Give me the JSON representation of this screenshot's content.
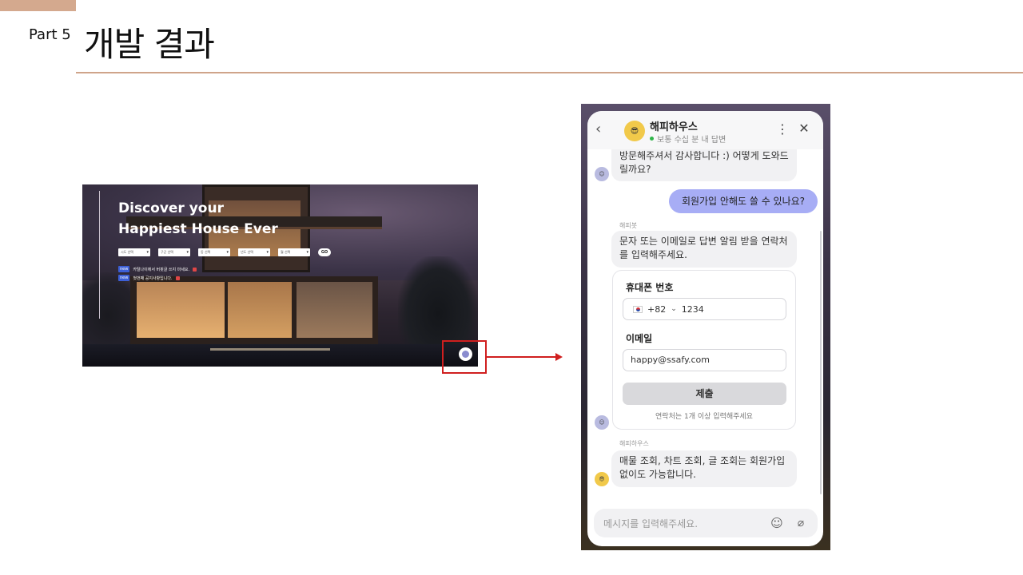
{
  "slide": {
    "part_label": "Part 5",
    "title": "개발 결과"
  },
  "website": {
    "hero_line1": "Discover your",
    "hero_line2": "Happiest House Ever",
    "selects": [
      "시도 선택",
      "구군 선택",
      "동 선택",
      "년도 선택",
      "월 선택"
    ],
    "go_label": "GO",
    "notices": [
      {
        "badge": "new",
        "text": "카탈나이에서 버핏글 쓰지 마세요."
      },
      {
        "badge": "new",
        "text": "첫번째 공지사항입니다."
      }
    ]
  },
  "chat": {
    "bot_name": "해피하우스",
    "status": "보통 수십 분 내 답변",
    "greeting": "방문해주셔서 감사합니다 :) 어떻게 도와드릴까요?",
    "user_message": "회원가입 안해도 쓸 수 있나요?",
    "sender1": "해피봇",
    "contact_prompt": "문자 또는 이메일로 답변 알림 받을 연락처를 입력해주세요.",
    "form": {
      "phone_label": "휴대폰 번호",
      "country_code": "+82",
      "phone_value": "1234",
      "email_label": "이메일",
      "email_value": "happy@ssafy.com",
      "submit_label": "제출",
      "hint": "연락처는 1개 이상 입력해주세요"
    },
    "sender2": "해피하우스",
    "answer": "매물 조회, 차트 조회, 글 조회는 회원가입 없이도 가능합니다.",
    "input_placeholder": "메시지를 입력해주세요."
  },
  "colors": {
    "accent": "#d4a98e",
    "highlight": "#d01f1f",
    "user_bubble": "#a7adf5"
  }
}
